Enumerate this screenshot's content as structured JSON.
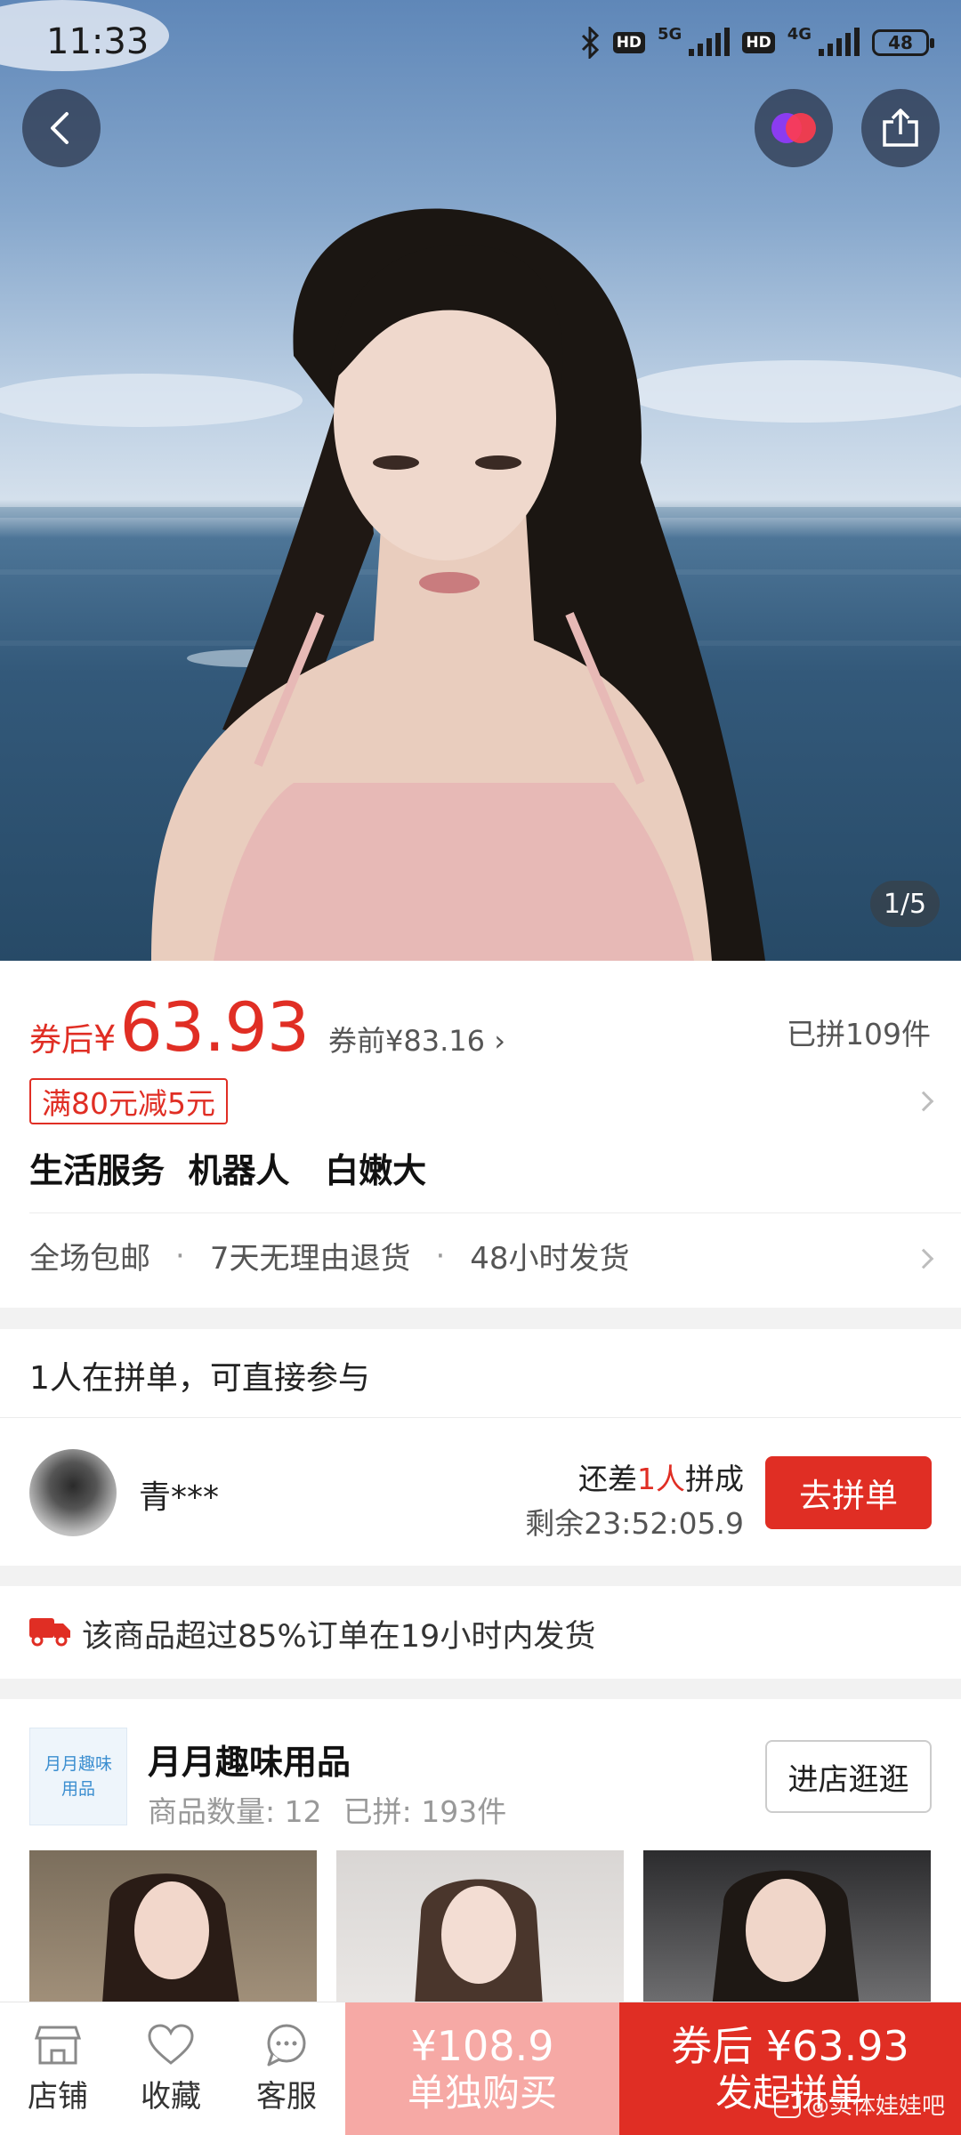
{
  "status_bar": {
    "time": "11:33",
    "network_1": "5G",
    "network_2": "4G",
    "hd_label": "HD",
    "battery": "48"
  },
  "hero": {
    "page_indicator": "1/5",
    "icons": [
      "back-icon",
      "brand-icon",
      "share-icon"
    ]
  },
  "price": {
    "prefix": "券后",
    "currency": "¥",
    "value": "63.93",
    "before": "券前¥83.16 ›",
    "sold": "已拼109件",
    "coupon": "满80元减5元"
  },
  "product": {
    "title": "生活服务  机器人   白嫩大"
  },
  "services": {
    "items": [
      "全场包邮",
      "7天无理由退货",
      "48小时发货"
    ],
    "separator": "·"
  },
  "group": {
    "header": "1人在拼单，可直接参与",
    "user": "青***",
    "need_prefix": "还差",
    "need_count": "1人",
    "need_suffix": "拼成",
    "timer": "剩余23:52:05.9",
    "join_label": "去拼单"
  },
  "shipping": {
    "text": "该商品超过85%订单在19小时内发货"
  },
  "store": {
    "logo_text": "月月趣味用品",
    "name": "月月趣味用品",
    "count": "商品数量: 12",
    "sold": "已拼: 193件",
    "visit_label": "进店逛逛"
  },
  "bottom_bar": {
    "store_label": "店铺",
    "fav_label": "收藏",
    "service_label": "客服",
    "alone_price": "¥108.9",
    "alone_label": "单独购买",
    "group_price": "券后 ¥63.93",
    "group_label": "发起拼单",
    "watermark": "@实体娃娃吧"
  },
  "colors": {
    "accent": "#e02e24",
    "accent_light": "#f6a9a5"
  }
}
